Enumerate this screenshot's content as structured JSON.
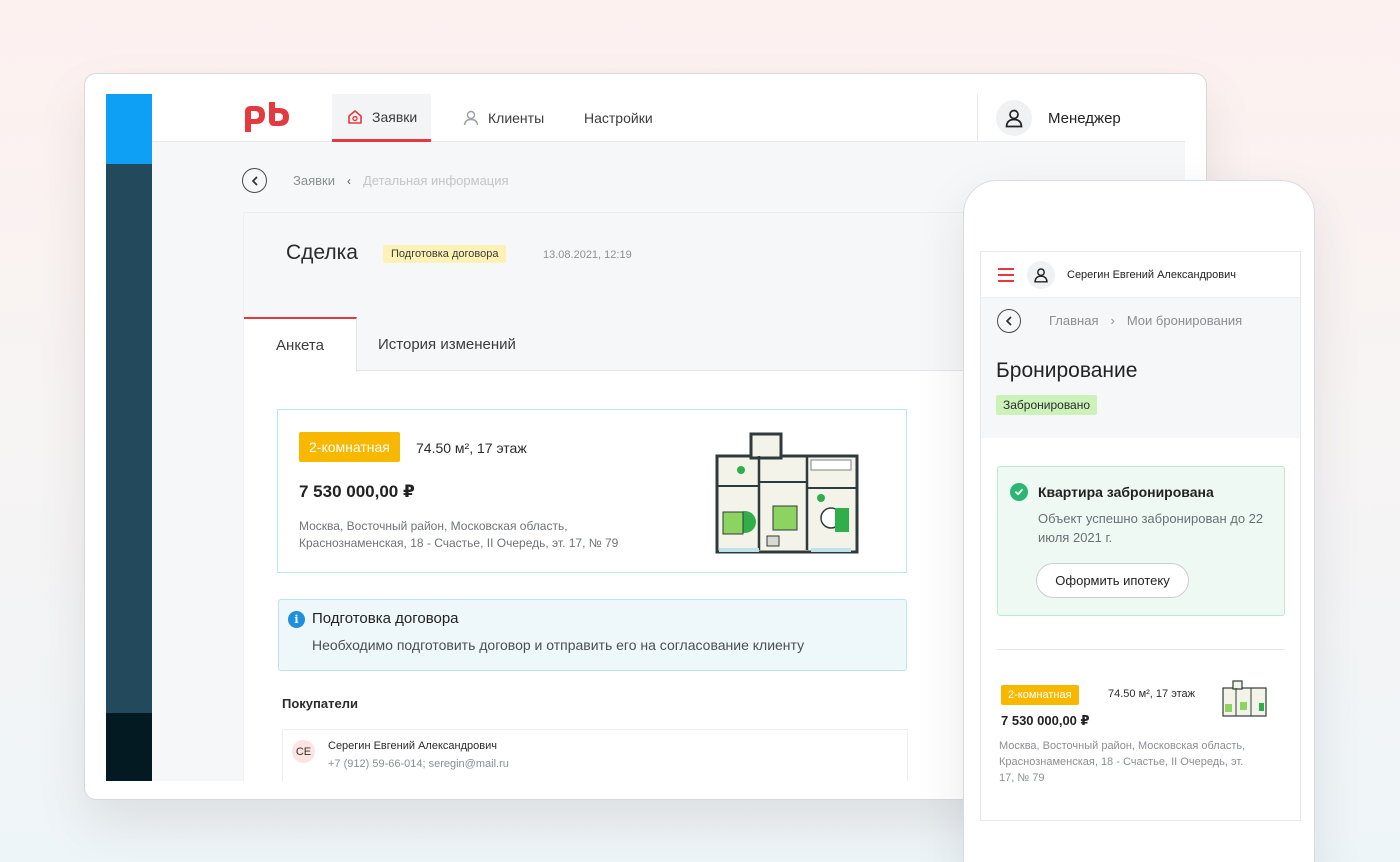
{
  "desktop": {
    "nav": {
      "items": [
        {
          "label": "Заявки",
          "icon": "home-icon",
          "active": true
        },
        {
          "label": "Клиенты",
          "icon": "user-icon",
          "active": false
        },
        {
          "label": "Настройки",
          "active": false
        }
      ],
      "user_label": "Менеджер"
    },
    "breadcrumb": {
      "items": [
        "Заявки",
        "Детальная информация"
      ]
    },
    "deal": {
      "title": "Сделка",
      "status_badge": "Подготовка договора",
      "date": "13.08.2021, 12:19"
    },
    "tabs": [
      "Анкета",
      "История изменений"
    ],
    "flat": {
      "rooms_badge": "2-комнатная",
      "meta": "74.50 м², 17 этаж",
      "price": "7 530 000,00 ₽",
      "address": "Москва, Восточный район, Московская область, Краснознаменская, 18 - Счастье, II Очередь, эт. 17, № 79"
    },
    "info": {
      "title": "Подготовка договора",
      "text": "Необходимо подготовить договор и отправить его на согласование клиенту"
    },
    "buyers": {
      "label": "Покупатели",
      "items": [
        {
          "initials": "СЕ",
          "name": "Серегин Евгений Александрович",
          "contact": "+7 (912) 59-66-014; seregin@mail.ru"
        }
      ]
    }
  },
  "mobile": {
    "user_name": "Серегин Евгений Александрович",
    "breadcrumb": [
      "Главная",
      "Мои бронирования"
    ],
    "title": "Бронирование",
    "status_badge": "Забронировано",
    "success": {
      "title": "Квартира забронирована",
      "text": "Объект успешно забронирован до 22 июля 2021 г.",
      "button": "Оформить ипотеку"
    },
    "flat": {
      "rooms_badge": "2-комнатная",
      "meta": "74.50 м², 17 этаж",
      "price": "7 530 000,00 ₽",
      "address": "Москва, Восточный район, Московская область, Краснознаменская, 18 - Счастье, II Очередь, эт. 17, № 79"
    }
  },
  "colors": {
    "brand_red": "#e5393f",
    "accent_blue": "#0ea0f5",
    "rail_dark": "#224a5c",
    "badge_yellow": "#f9b800",
    "success_green": "#2bb673"
  }
}
